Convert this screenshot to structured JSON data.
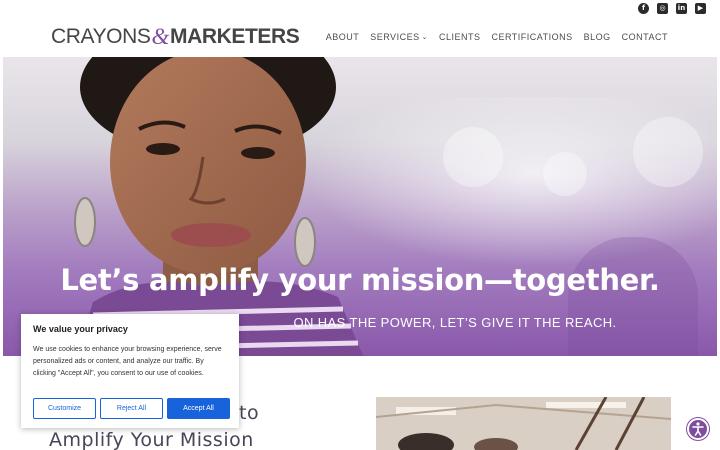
{
  "header": {
    "logo_part1": "CRAYONS",
    "logo_amp": "&",
    "logo_part2": "MARKETERS",
    "social_icons": [
      {
        "icon": "facebook-icon",
        "glyph": "f"
      },
      {
        "icon": "instagram-icon",
        "glyph": "◎"
      },
      {
        "icon": "linkedin-icon",
        "glyph": "in"
      },
      {
        "icon": "youtube-icon",
        "glyph": "▶"
      }
    ],
    "nav": {
      "about": "ABOUT",
      "services": "SERVICES",
      "clients": "CLIENTS",
      "certifications": "CERTIFICATIONS",
      "blog": "BLOG",
      "contact": "CONTACT"
    }
  },
  "hero": {
    "title": "Let’s amplify your mission—together.",
    "subtitle_visible": "ON HAS THE POWER, LET’S GIVE IT THE REACH."
  },
  "section": {
    "heading_line1": "to",
    "heading_line2": "Amplify Your Mission"
  },
  "cookie_banner": {
    "title": "We value your privacy",
    "body": "We use cookies to enhance your browsing experience, serve personalized ads or content, and analyze our traffic. By clicking \"Accept All\", you consent to our use of cookies.",
    "customize_label": "Customize",
    "reject_label": "Reject All",
    "accept_label": "Accept All"
  },
  "colors": {
    "brand_purple": "#7e4e9e",
    "cookie_blue": "#1863dc",
    "text_dark": "#4e4e4e"
  },
  "accessibility": {
    "icon": "accessibility-icon"
  }
}
